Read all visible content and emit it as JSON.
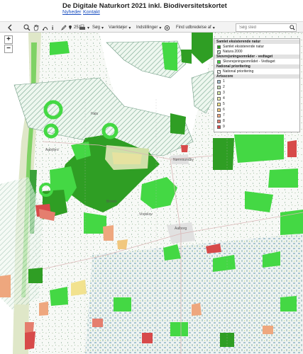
{
  "header": {
    "title": "De Digitale Naturkort 2021 inkl. Biodiversitetskortet",
    "links": {
      "nyheder": "Nyheder",
      "kontakt": "Kontakt"
    }
  },
  "toolbar": {
    "icons": [
      "back-icon",
      "zoom-icon",
      "pan-hand-icon",
      "measure-icon",
      "info-icon",
      "draw-icon",
      "print-icon"
    ],
    "counter": "251",
    "menus": {
      "sog": "Søg",
      "vaerktojer": "Værktøjer",
      "indstillinger": "Indstillinger",
      "find_udbredelse": "Find udbredelse af"
    },
    "search_placeholder": "Søg sted"
  },
  "map_controls": {
    "zoom_in": "+",
    "zoom_out": "−"
  },
  "legend": {
    "sections": [
      {
        "title": "Samlet eksisterende natur",
        "items": [
          {
            "label": "Samlet eksisterende natur",
            "color": "#2e9e22"
          },
          {
            "label": "Natura 2000",
            "color": "#ffffff",
            "pattern": "hatch"
          }
        ]
      },
      {
        "title": "Skovrejsningsområder - vedtaget",
        "items": [
          {
            "label": "Skovrejsningsområdet - Vedtaget",
            "color": "#44d844"
          }
        ]
      },
      {
        "title": "National prioritering",
        "items": [
          {
            "label": "National prioritering",
            "color": "#ffffff",
            "pattern": "diag"
          }
        ]
      },
      {
        "title": "Artsscore",
        "items": [
          {
            "label": "1",
            "color": "#a8c4d2"
          },
          {
            "label": "2",
            "color": "#c6d9b4"
          },
          {
            "label": "3",
            "color": "#d6e7a8"
          },
          {
            "label": "4",
            "color": "#ecebb0"
          },
          {
            "label": "5",
            "color": "#f2e28e"
          },
          {
            "label": "6",
            "color": "#f1c77e"
          },
          {
            "label": "7",
            "color": "#eea77e"
          },
          {
            "label": "8",
            "color": "#e57e6e"
          },
          {
            "label": "9",
            "color": "#d74a4a"
          }
        ]
      }
    ]
  },
  "place_labels": [
    "Hals",
    "Aabybro",
    "Nørresundby",
    "Brovst",
    "Vodskov",
    "Aalborg"
  ]
}
